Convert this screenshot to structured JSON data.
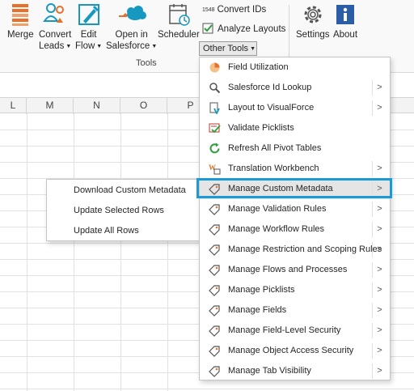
{
  "ribbon": {
    "buttons": [
      {
        "label": "Merge",
        "icon": "merge-icon"
      },
      {
        "label": "Convert Leads",
        "line1": "Convert",
        "line2": "Leads",
        "icon": "convert-leads-icon"
      },
      {
        "label": "Edit Flow",
        "line1": "Edit",
        "line2": "Flow",
        "icon": "edit-flow-icon"
      },
      {
        "label": "Open in Salesforce",
        "line1": "Open in",
        "line2": "Salesforce",
        "icon": "salesforce-cloud-icon"
      },
      {
        "label": "Scheduler",
        "icon": "scheduler-icon"
      },
      {
        "label": "Settings",
        "icon": "gear-icon"
      },
      {
        "label": "About",
        "icon": "info-icon"
      }
    ],
    "convert_ids": {
      "badge": "1548",
      "label": "Convert IDs"
    },
    "analyze_layouts": {
      "label": "Analyze Layouts"
    },
    "other_tools": {
      "label": "Other Tools"
    },
    "group_label": "Tools"
  },
  "grid": {
    "columns": [
      "L",
      "M",
      "N",
      "O",
      "P"
    ]
  },
  "other_tools_menu": {
    "items": [
      {
        "label": "Field Utilization",
        "icon": "pie-chart-icon",
        "has_submenu": false
      },
      {
        "label": "Salesforce Id Lookup",
        "icon": "magnifier-icon",
        "has_submenu": true
      },
      {
        "label": "Layout to VisualForce",
        "icon": "visualforce-icon",
        "has_submenu": true
      },
      {
        "label": "Validate Picklists",
        "icon": "checklist-icon",
        "has_submenu": false
      },
      {
        "label": "Refresh All Pivot Tables",
        "icon": "refresh-icon",
        "has_submenu": false
      },
      {
        "label": "Translation Workbench",
        "icon": "translation-icon",
        "has_submenu": true
      },
      {
        "label": "Manage Custom Metadata",
        "icon": "tag-icon",
        "has_submenu": true,
        "active": true
      },
      {
        "label": "Manage Validation Rules",
        "icon": "tag-icon",
        "has_submenu": true
      },
      {
        "label": "Manage Workflow Rules",
        "icon": "tag-icon",
        "has_submenu": true
      },
      {
        "label": "Manage Restriction and Scoping Rules",
        "icon": "tag-icon",
        "has_submenu": true
      },
      {
        "label": "Manage Flows and Processes",
        "icon": "tag-icon",
        "has_submenu": true
      },
      {
        "label": "Manage Picklists",
        "icon": "tag-icon",
        "has_submenu": true
      },
      {
        "label": "Manage Fields",
        "icon": "tag-icon",
        "has_submenu": true
      },
      {
        "label": "Manage Field-Level Security",
        "icon": "tag-icon",
        "has_submenu": true
      },
      {
        "label": "Manage Object Access Security",
        "icon": "tag-icon",
        "has_submenu": true
      },
      {
        "label": "Manage Tab Visibility",
        "icon": "tag-icon",
        "has_submenu": true
      }
    ],
    "submenu_arrow": ">"
  },
  "custom_metadata_submenu": {
    "items": [
      {
        "label": "Download Custom Metadata"
      },
      {
        "label": "Update Selected Rows"
      },
      {
        "label": "Update All Rows"
      }
    ]
  },
  "colors": {
    "highlight": "#1a9ad6",
    "salesforce_blue": "#1798c1",
    "orange": "#e8702a"
  }
}
